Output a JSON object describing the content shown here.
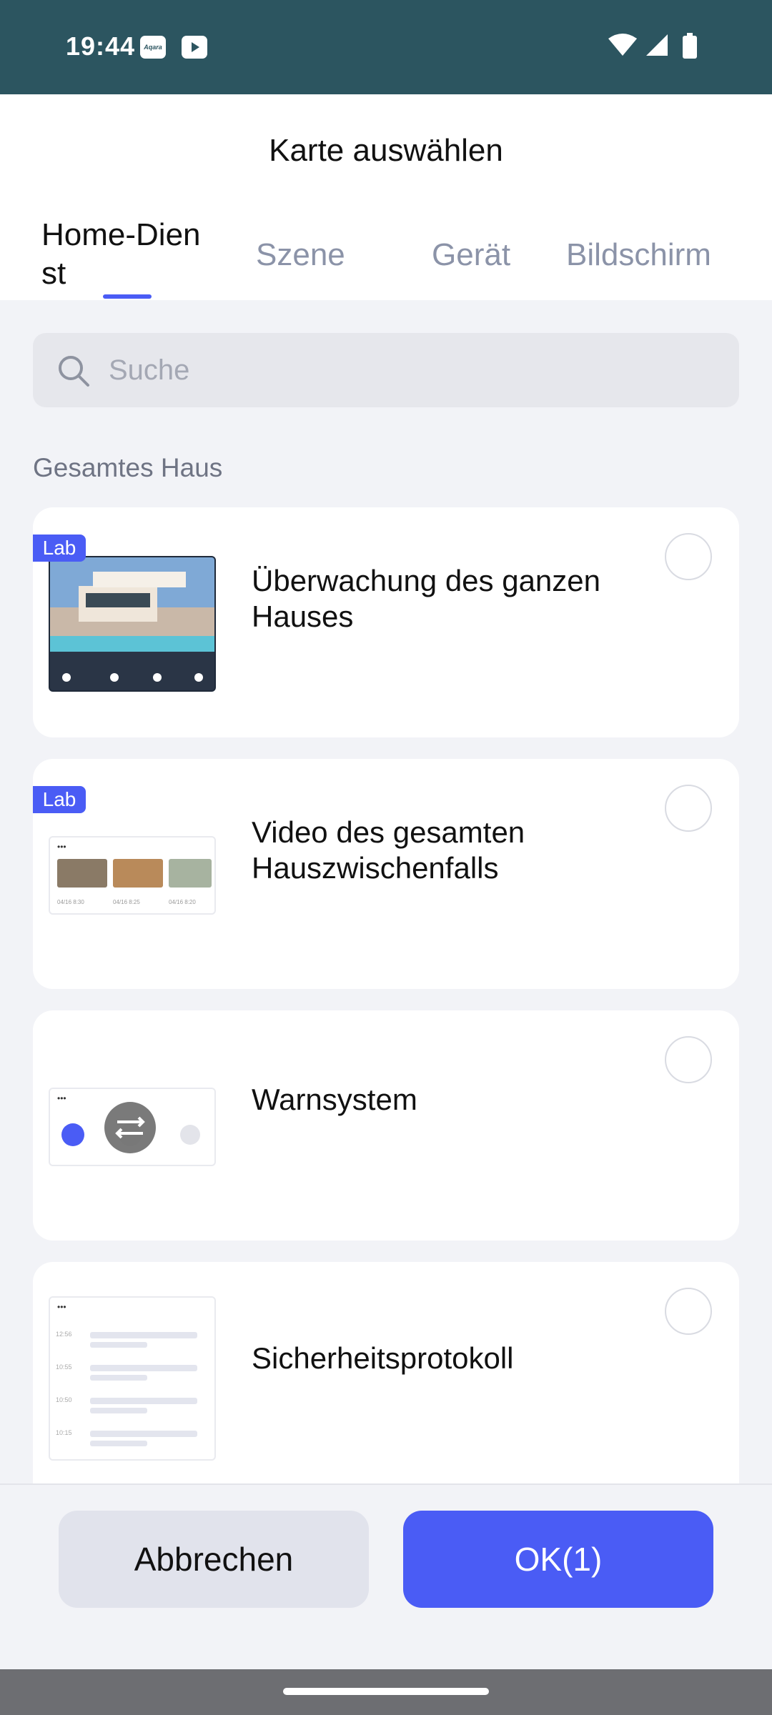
{
  "status_bar": {
    "time": "19:44",
    "aqara_badge": "Aqara"
  },
  "header": {
    "title": "Karte auswählen"
  },
  "tabs": [
    {
      "label": "Home-Dien\nst",
      "active": true
    },
    {
      "label": "Szene",
      "active": false
    },
    {
      "label": "Gerät",
      "active": false
    },
    {
      "label": "Bildschirm",
      "active": false
    }
  ],
  "search": {
    "placeholder": "Suche"
  },
  "section_title": "Gesamtes Haus",
  "cards": [
    {
      "label": "Überwachung des ganzen Hauses",
      "badge": "Lab",
      "selected": false
    },
    {
      "label": "Video des gesamten Hauszwischenfalls",
      "badge": "Lab",
      "selected": false
    },
    {
      "label": "Warnsystem",
      "badge": "",
      "selected": false
    },
    {
      "label": "Sicherheitsprotokoll",
      "badge": "",
      "selected": false
    }
  ],
  "thumb_text": {
    "dots": "•••",
    "video_times": [
      "04/16 8:30",
      "04/16 8:25",
      "04/16 8:20"
    ],
    "log_times": [
      "12:56",
      "10:55",
      "10:50",
      "10:15"
    ]
  },
  "footer": {
    "cancel_label": "Abbrechen",
    "ok_label": "OK(1)"
  },
  "colors": {
    "accent": "#4a5cf5",
    "status_bar": "#2c5560",
    "background": "#f2f3f7"
  }
}
